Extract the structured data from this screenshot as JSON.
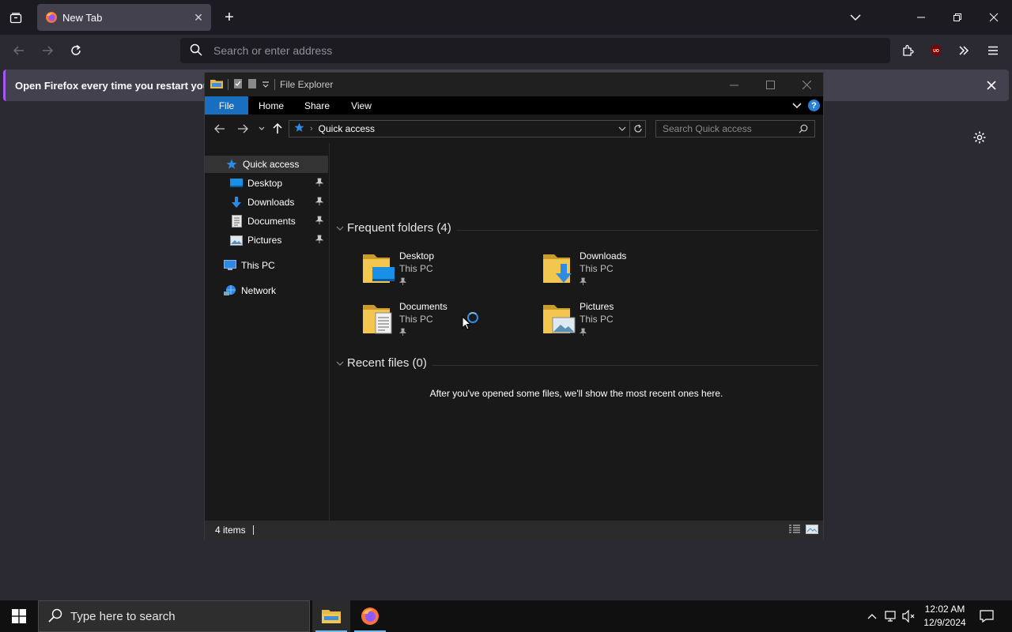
{
  "browser": {
    "tab": {
      "title": "New Tab"
    },
    "url_placeholder": "Search or enter address",
    "infobar_text": "Open Firefox every time you restart your co"
  },
  "explorer": {
    "title": "File Explorer",
    "ribbon_tabs": [
      "File",
      "Home",
      "Share",
      "View"
    ],
    "help_glyph": "?",
    "breadcrumb": "Quick access",
    "search_placeholder": "Search Quick access",
    "nav": {
      "quick_access": "Quick access",
      "desktop": "Desktop",
      "downloads": "Downloads",
      "documents": "Documents",
      "pictures": "Pictures",
      "this_pc": "This PC",
      "network": "Network"
    },
    "frequent_title": "Frequent folders (4)",
    "recent_title": "Recent files (0)",
    "folders": [
      {
        "name": "Desktop",
        "location": "This PC"
      },
      {
        "name": "Downloads",
        "location": "This PC"
      },
      {
        "name": "Documents",
        "location": "This PC"
      },
      {
        "name": "Pictures",
        "location": "This PC"
      }
    ],
    "empty_message": "After you've opened some files, we'll show the most recent ones here.",
    "status_count": "4 items"
  },
  "taskbar": {
    "search_placeholder": "Type here to search",
    "time": "12:02 AM",
    "date": "12/9/2024"
  },
  "colors": {
    "accent": "#1a6ec0",
    "firefox_infobar_accent": "#a656f4",
    "taskbar_active": "#76b9ed"
  }
}
